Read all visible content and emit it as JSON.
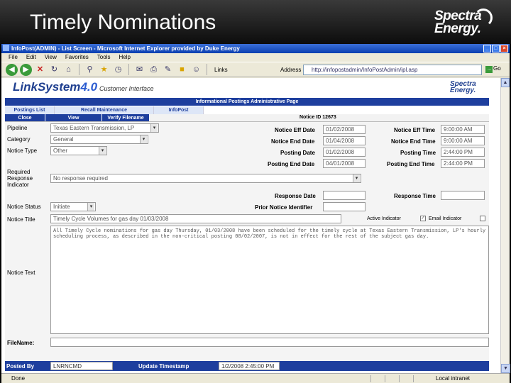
{
  "slide": {
    "title": "Timely Nominations",
    "logo_line1": "Spectra",
    "logo_line2": "Energy."
  },
  "browser": {
    "window_title": "InfoPost(ADMIN) - List Screen - Microsoft Internet Explorer provided by Duke Energy",
    "menu": [
      "File",
      "Edit",
      "View",
      "Favorites",
      "Tools",
      "Help"
    ],
    "links_label": "Links",
    "address_label": "Address",
    "address_value": "http://infopostadmin/InfoPostAdmin/ipl.asp",
    "go_label": "Go",
    "status_text": "Done",
    "zone_text": "Local intranet"
  },
  "app": {
    "logo": "LinkSystem",
    "version": "4.0",
    "subtitle": "Customer Interface",
    "brand_line1": "Spectra",
    "brand_line2": "Energy.",
    "page_header": "Informational Postings Administrative Page",
    "tabs": [
      "Postings List",
      "Recall Maintenance",
      "InfoPost"
    ],
    "buttons": [
      "Close",
      "View",
      "Verify Filename"
    ],
    "notice_id_label": "Notice ID 12673"
  },
  "form": {
    "pipeline_label": "Pipeline",
    "pipeline_value": "Texas Eastern Transmission, LP",
    "category_label": "Category",
    "category_value": "General",
    "notice_type_label": "Notice Type",
    "notice_type_value": "Other",
    "required_response_label": [
      "Required",
      "Response",
      "Indicator"
    ],
    "required_response_value": "No response required",
    "notice_status_label": "Notice Status",
    "notice_status_value": "Initiate",
    "notice_eff_date_label": "Notice Eff Date",
    "notice_eff_date": "01/02/2008",
    "notice_end_date_label": "Notice End Date",
    "notice_end_date": "01/04/2008",
    "posting_date_label": "Posting Date",
    "posting_date": "01/02/2008",
    "posting_end_date_label": "Posting End Date",
    "posting_end_date": "04/01/2008",
    "notice_eff_time_label": "Notice Eff Time",
    "notice_eff_time": "9:00:00 AM",
    "notice_end_time_label": "Notice End Time",
    "notice_end_time": "9:00:00 AM",
    "posting_time_label": "Posting Time",
    "posting_time": "2:44:00 PM",
    "posting_end_time_label": "Posting End Time",
    "posting_end_time": "2:44:00 PM",
    "response_date_label": "Response Date",
    "response_time_label": "Response Time",
    "prior_notice_label": "Prior Notice Identifier",
    "active_indicator_label": "Active Indicator",
    "email_indicator_label": "Email Indicator",
    "notice_title_label": "Notice Title",
    "notice_title_value": "Timely Cycle Volumes for gas day 01/03/2008",
    "notice_text_label": "Notice Text",
    "notice_text_value": "All Timely Cycle nominations for gas day Thursday, 01/03/2008 have been scheduled for the timely cycle at Texas Eastern Transmission, LP's hourly scheduling process, as described in the non-critical posting 08/02/2007, is not in effect for the rest of the subject gas day.",
    "filename_label": "FileName:",
    "posted_by_label": "Posted By",
    "posted_by_value": "LNRNCMD",
    "update_ts_label": "Update Timestamp",
    "update_ts_value": "1/2/2008 2:45:00 PM"
  }
}
